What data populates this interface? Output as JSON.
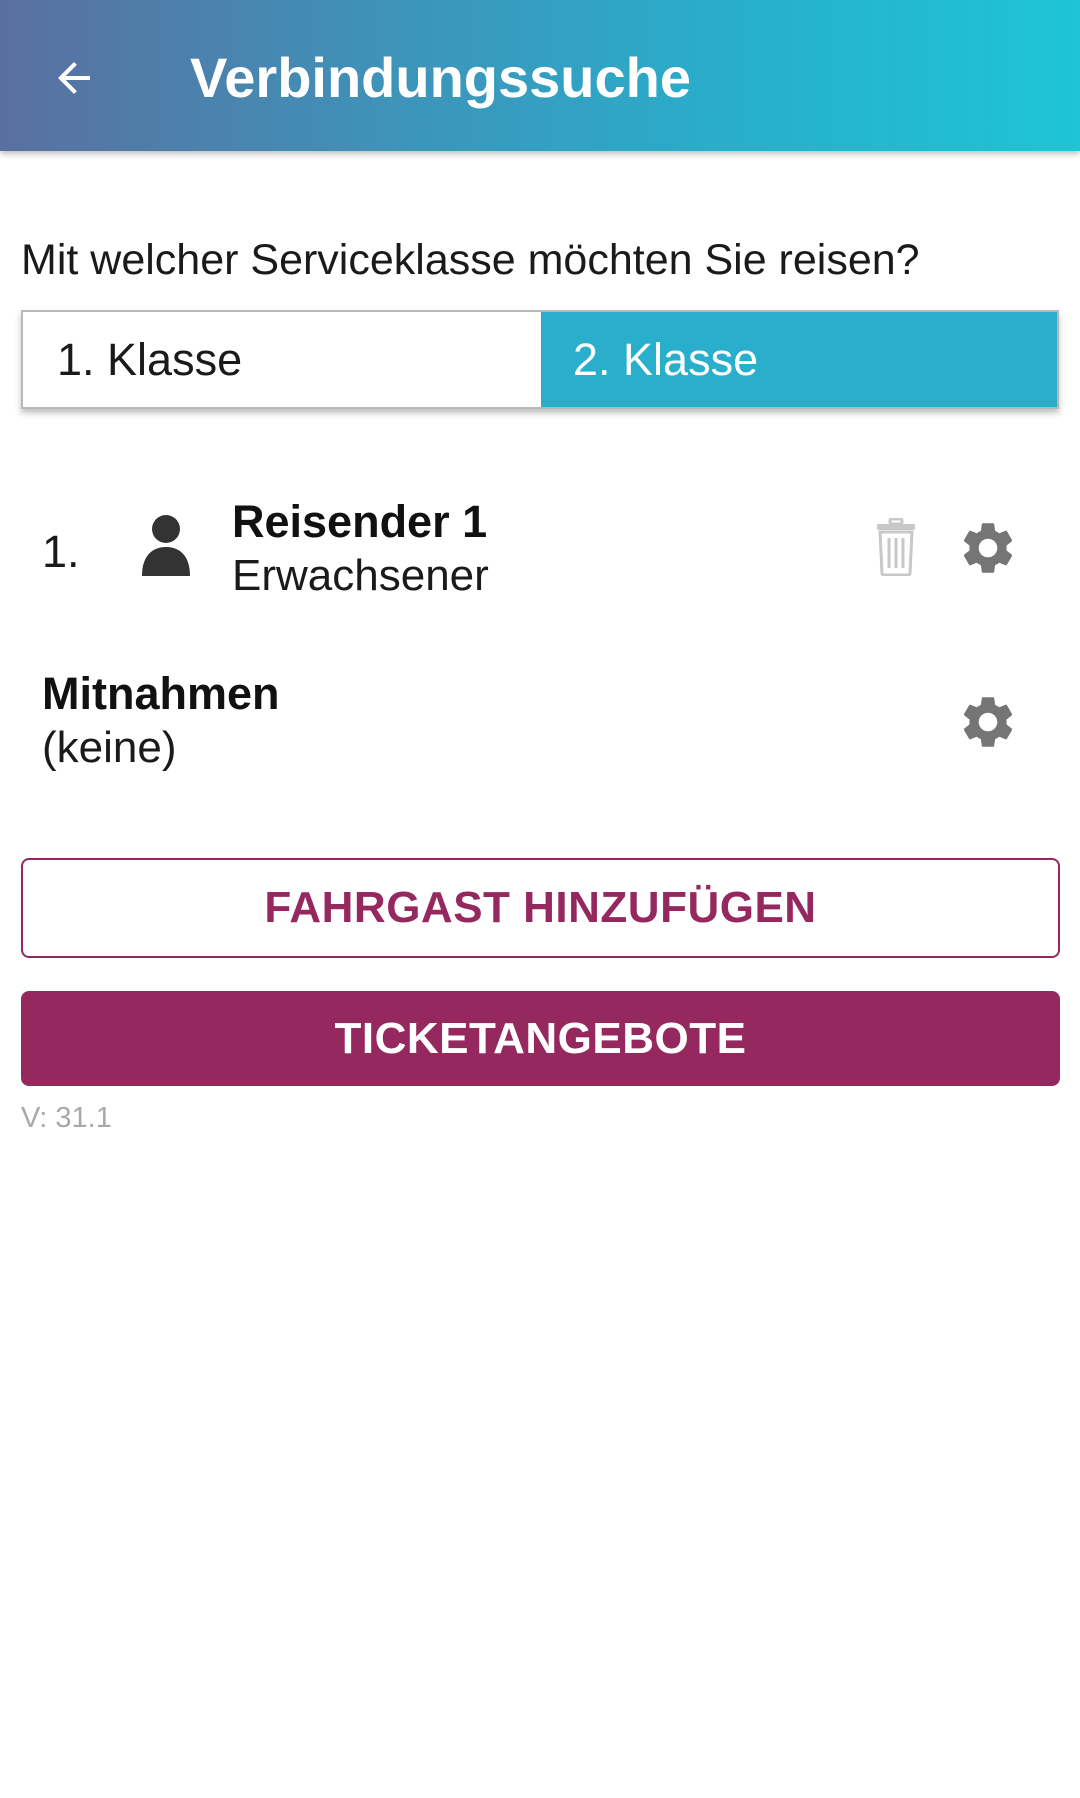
{
  "appbar": {
    "title": "Verbindungssuche",
    "back_icon": "arrow-left-icon",
    "gradient_start": "#5a6fa0",
    "gradient_end": "#1ec4d8"
  },
  "service_class": {
    "question": "Mit welcher Serviceklasse möchten Sie reisen?",
    "options": [
      {
        "label": "1. Klasse",
        "selected": false
      },
      {
        "label": "2. Klasse",
        "selected": true
      }
    ],
    "active_color": "#29afcc"
  },
  "travelers": [
    {
      "index": "1.",
      "name": "Reisender 1",
      "type": "Erwachsener",
      "icons": [
        "person-icon",
        "trash-icon",
        "gear-icon"
      ]
    }
  ],
  "extras": {
    "title": "Mitnahmen",
    "value": "(keine)",
    "icon": "gear-icon"
  },
  "buttons": {
    "add_passenger": "FAHRGAST HINZUFÜGEN",
    "ticket_offers": "TICKETANGEBOTE",
    "brand_color": "#95295f"
  },
  "footer": {
    "version": "V: 31.1"
  }
}
